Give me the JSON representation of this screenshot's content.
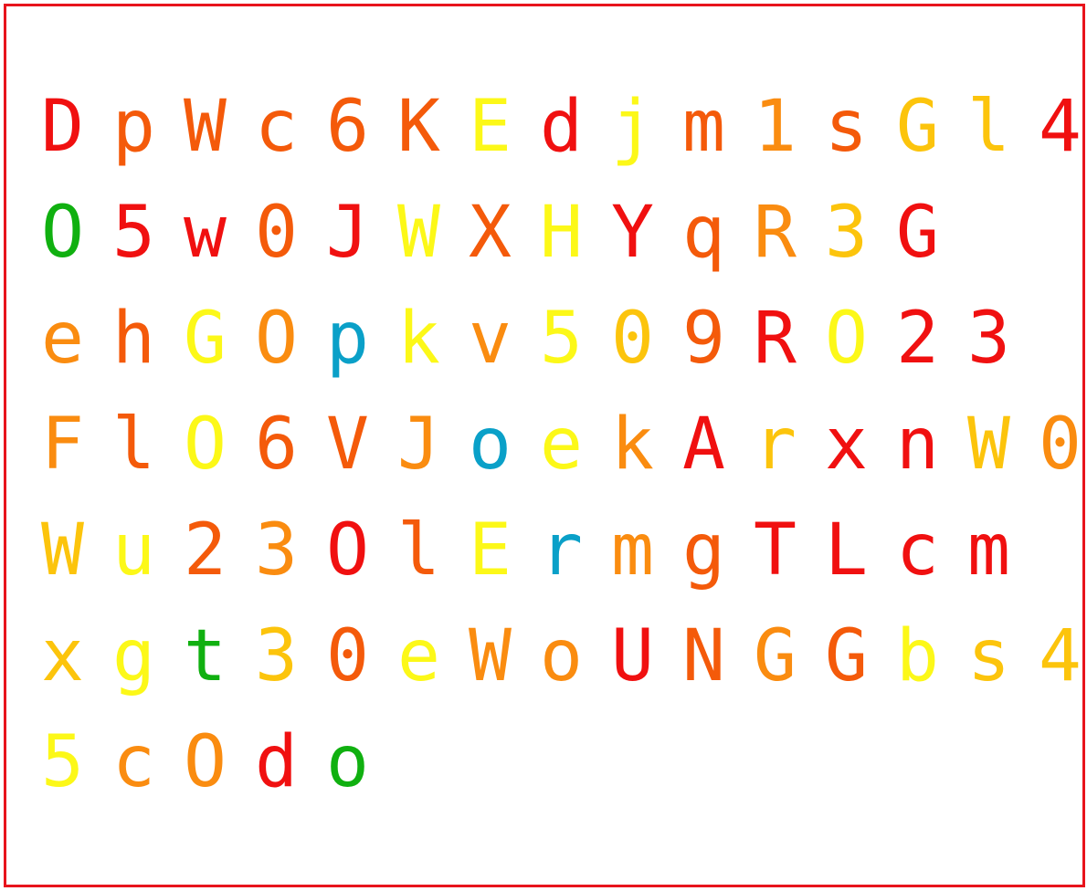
{
  "palette": {
    "red": "#f01010",
    "orange_red": "#f45a0a",
    "orange": "#fa8c10",
    "amber": "#fcc40c",
    "yellow": "#fcf818",
    "green": "#10b010",
    "blue": "#0aa0c8",
    "border": "#e8141c"
  },
  "rows": [
    [
      {
        "c": "D",
        "col": "#f01010"
      },
      {
        "c": "p",
        "col": "#f45a0a"
      },
      {
        "c": "W",
        "col": "#f45a0a"
      },
      {
        "c": "c",
        "col": "#f45a0a"
      },
      {
        "c": "6",
        "col": "#f45a0a"
      },
      {
        "c": "K",
        "col": "#f45a0a"
      },
      {
        "c": "E",
        "col": "#fcf818"
      },
      {
        "c": "d",
        "col": "#f01010"
      },
      {
        "c": "j",
        "col": "#fcf818"
      },
      {
        "c": "m",
        "col": "#f45a0a"
      },
      {
        "c": "1",
        "col": "#fa8c10"
      },
      {
        "c": "s",
        "col": "#f45a0a"
      },
      {
        "c": "G",
        "col": "#fcc40c"
      },
      {
        "c": "l",
        "col": "#fcc40c"
      },
      {
        "c": "4",
        "col": "#f01010"
      }
    ],
    [
      {
        "c": "O",
        "col": "#10b010"
      },
      {
        "c": "5",
        "col": "#f01010"
      },
      {
        "c": "w",
        "col": "#f01010"
      },
      {
        "c": "0",
        "col": "#f45a0a"
      },
      {
        "c": "J",
        "col": "#f01010"
      },
      {
        "c": "W",
        "col": "#fcf818"
      },
      {
        "c": "X",
        "col": "#f45a0a"
      },
      {
        "c": "H",
        "col": "#fcf818"
      },
      {
        "c": "Y",
        "col": "#f01010"
      },
      {
        "c": "q",
        "col": "#f45a0a"
      },
      {
        "c": "R",
        "col": "#fa8c10"
      },
      {
        "c": "3",
        "col": "#fcc40c"
      },
      {
        "c": "G",
        "col": "#f01010"
      }
    ],
    [
      {
        "c": "e",
        "col": "#fa8c10"
      },
      {
        "c": "h",
        "col": "#f45a0a"
      },
      {
        "c": "G",
        "col": "#fcf818"
      },
      {
        "c": "O",
        "col": "#fa8c10"
      },
      {
        "c": "p",
        "col": "#0aa0c8"
      },
      {
        "c": "k",
        "col": "#fcf818"
      },
      {
        "c": "v",
        "col": "#fa8c10"
      },
      {
        "c": "5",
        "col": "#fcf818"
      },
      {
        "c": "0",
        "col": "#fcc40c"
      },
      {
        "c": "9",
        "col": "#f45a0a"
      },
      {
        "c": "R",
        "col": "#f01010"
      },
      {
        "c": "O",
        "col": "#fcf818"
      },
      {
        "c": "2",
        "col": "#f01010"
      },
      {
        "c": "3",
        "col": "#f01010"
      }
    ],
    [
      {
        "c": "F",
        "col": "#fa8c10"
      },
      {
        "c": "l",
        "col": "#f45a0a"
      },
      {
        "c": "O",
        "col": "#fcf818"
      },
      {
        "c": "6",
        "col": "#f45a0a"
      },
      {
        "c": "V",
        "col": "#f45a0a"
      },
      {
        "c": "J",
        "col": "#fa8c10"
      },
      {
        "c": "o",
        "col": "#0aa0c8"
      },
      {
        "c": "e",
        "col": "#fcf818"
      },
      {
        "c": "k",
        "col": "#fa8c10"
      },
      {
        "c": "A",
        "col": "#f01010"
      },
      {
        "c": "r",
        "col": "#fcc40c"
      },
      {
        "c": "x",
        "col": "#f01010"
      },
      {
        "c": "n",
        "col": "#f01010"
      },
      {
        "c": "W",
        "col": "#fcc40c"
      },
      {
        "c": "0",
        "col": "#fa8c10"
      }
    ],
    [
      {
        "c": "W",
        "col": "#fcc40c"
      },
      {
        "c": "u",
        "col": "#fcf818"
      },
      {
        "c": "2",
        "col": "#f45a0a"
      },
      {
        "c": "3",
        "col": "#fa8c10"
      },
      {
        "c": "O",
        "col": "#f01010"
      },
      {
        "c": "l",
        "col": "#f45a0a"
      },
      {
        "c": "E",
        "col": "#fcf818"
      },
      {
        "c": "r",
        "col": "#0aa0c8"
      },
      {
        "c": "m",
        "col": "#fa8c10"
      },
      {
        "c": "g",
        "col": "#f45a0a"
      },
      {
        "c": "T",
        "col": "#f01010"
      },
      {
        "c": "L",
        "col": "#f01010"
      },
      {
        "c": "c",
        "col": "#f01010"
      },
      {
        "c": "m",
        "col": "#f01010"
      }
    ],
    [
      {
        "c": "x",
        "col": "#fcc40c"
      },
      {
        "c": "g",
        "col": "#fcf818"
      },
      {
        "c": "t",
        "col": "#10b010"
      },
      {
        "c": "3",
        "col": "#fcc40c"
      },
      {
        "c": "0",
        "col": "#f45a0a"
      },
      {
        "c": "e",
        "col": "#fcf818"
      },
      {
        "c": "W",
        "col": "#fa8c10"
      },
      {
        "c": "o",
        "col": "#fa8c10"
      },
      {
        "c": "U",
        "col": "#f01010"
      },
      {
        "c": "N",
        "col": "#f45a0a"
      },
      {
        "c": "G",
        "col": "#fa8c10"
      },
      {
        "c": "G",
        "col": "#f45a0a"
      },
      {
        "c": "b",
        "col": "#fcf818"
      },
      {
        "c": "s",
        "col": "#fcc40c"
      },
      {
        "c": "4",
        "col": "#fcc40c"
      }
    ],
    [
      {
        "c": "5",
        "col": "#fcf818"
      },
      {
        "c": "c",
        "col": "#fa8c10"
      },
      {
        "c": "O",
        "col": "#fa8c10"
      },
      {
        "c": "d",
        "col": "#f01010"
      },
      {
        "c": "o",
        "col": "#10b010"
      }
    ]
  ]
}
